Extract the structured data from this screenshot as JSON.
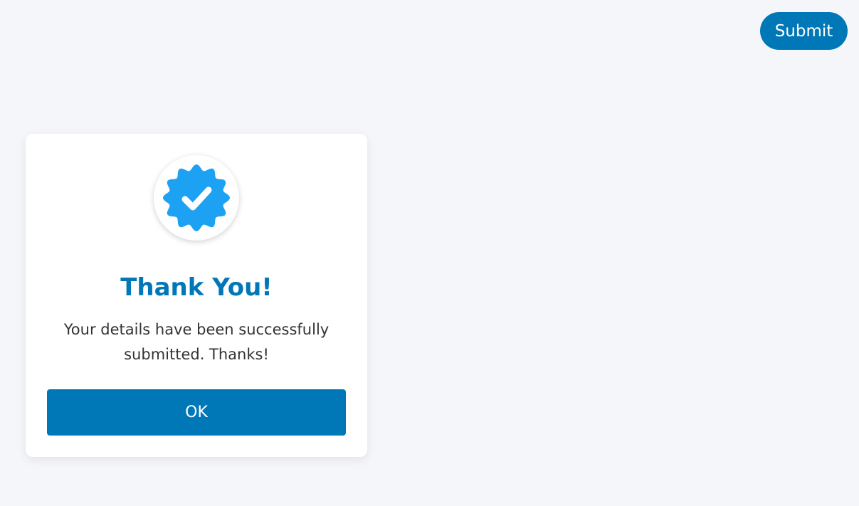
{
  "header": {
    "submit_label": "Submit"
  },
  "dialog": {
    "icon": "verified-badge-icon",
    "title": "Thank You!",
    "message": "Your details have been successfully submitted. Thanks!",
    "ok_label": "OK"
  },
  "colors": {
    "page_background": "#f5f6fa",
    "primary": "#0077b6",
    "badge": "#1da1f2",
    "text": "#333333"
  }
}
